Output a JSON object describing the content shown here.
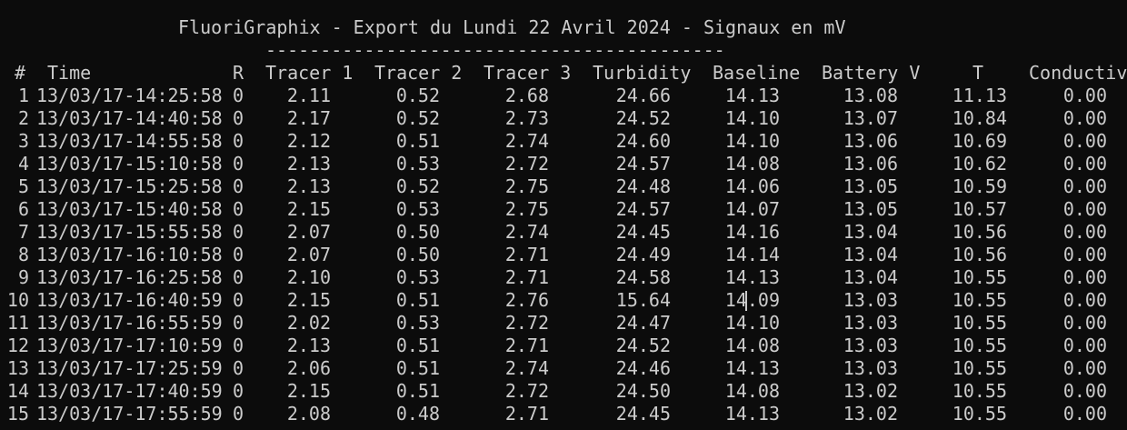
{
  "window": {
    "title": "FluoriGraphix - Export du Lundi 22 Avril 2024 - Signaux en mV",
    "separator": "------------------------------------------"
  },
  "table": {
    "headers": [
      "#",
      "Time",
      "R",
      "Tracer 1",
      "Tracer 2",
      "Tracer 3",
      "Turbidity",
      "Baseline",
      "Battery V",
      "T",
      "Conductiv"
    ],
    "rows": [
      [
        "1",
        "13/03/17-14:25:58",
        "0",
        "2.11",
        "0.52",
        "2.68",
        "24.66",
        "14.13",
        "13.08",
        "11.13",
        "0.00"
      ],
      [
        "2",
        "13/03/17-14:40:58",
        "0",
        "2.17",
        "0.52",
        "2.73",
        "24.52",
        "14.10",
        "13.07",
        "10.84",
        "0.00"
      ],
      [
        "3",
        "13/03/17-14:55:58",
        "0",
        "2.12",
        "0.51",
        "2.74",
        "24.60",
        "14.10",
        "13.06",
        "10.69",
        "0.00"
      ],
      [
        "4",
        "13/03/17-15:10:58",
        "0",
        "2.13",
        "0.53",
        "2.72",
        "24.57",
        "14.08",
        "13.06",
        "10.62",
        "0.00"
      ],
      [
        "5",
        "13/03/17-15:25:58",
        "0",
        "2.13",
        "0.52",
        "2.75",
        "24.48",
        "14.06",
        "13.05",
        "10.59",
        "0.00"
      ],
      [
        "6",
        "13/03/17-15:40:58",
        "0",
        "2.15",
        "0.53",
        "2.75",
        "24.57",
        "14.07",
        "13.05",
        "10.57",
        "0.00"
      ],
      [
        "7",
        "13/03/17-15:55:58",
        "0",
        "2.07",
        "0.50",
        "2.74",
        "24.45",
        "14.16",
        "13.04",
        "10.56",
        "0.00"
      ],
      [
        "8",
        "13/03/17-16:10:58",
        "0",
        "2.07",
        "0.50",
        "2.71",
        "24.49",
        "14.14",
        "13.04",
        "10.56",
        "0.00"
      ],
      [
        "9",
        "13/03/17-16:25:58",
        "0",
        "2.10",
        "0.53",
        "2.71",
        "24.58",
        "14.13",
        "13.04",
        "10.55",
        "0.00"
      ],
      [
        "10",
        "13/03/17-16:40:59",
        "0",
        "2.15",
        "0.51",
        "2.76",
        "15.64",
        "14.09",
        "13.03",
        "10.55",
        "0.00"
      ],
      [
        "11",
        "13/03/17-16:55:59",
        "0",
        "2.02",
        "0.53",
        "2.72",
        "24.47",
        "14.10",
        "13.03",
        "10.55",
        "0.00"
      ],
      [
        "12",
        "13/03/17-17:10:59",
        "0",
        "2.13",
        "0.51",
        "2.71",
        "24.52",
        "14.08",
        "13.03",
        "10.55",
        "0.00"
      ],
      [
        "13",
        "13/03/17-17:25:59",
        "0",
        "2.06",
        "0.51",
        "2.74",
        "24.46",
        "14.13",
        "13.03",
        "10.55",
        "0.00"
      ],
      [
        "14",
        "13/03/17-17:40:59",
        "0",
        "2.15",
        "0.51",
        "2.72",
        "24.50",
        "14.08",
        "13.02",
        "10.55",
        "0.00"
      ],
      [
        "15",
        "13/03/17-17:55:59",
        "0",
        "2.08",
        "0.48",
        "2.71",
        "24.45",
        "14.13",
        "13.02",
        "10.55",
        "0.00"
      ]
    ]
  },
  "colors": {
    "background": "#0c0c0c",
    "text": "#cccccc"
  }
}
